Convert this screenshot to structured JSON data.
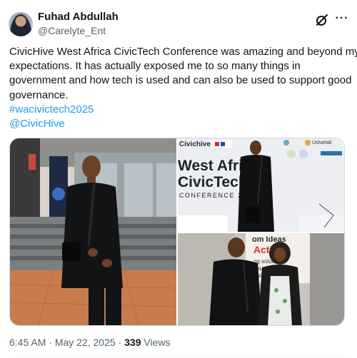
{
  "author": {
    "name": "Fuhad Abdullah",
    "handle": "@Carelyte_Ent"
  },
  "tweet": {
    "lines": [
      "CivicHive West Africa CivicTech Conference was amazing and beyond my",
      "expectations. It has actually exposed me to so many things in",
      "government and how tech is used and can also be used to support good",
      "governance."
    ],
    "hashtag": "#wacivictech2025",
    "mention": "@CivicHive"
  },
  "photos": {
    "banner_brand": "Civichive",
    "banner_title_line1": "West Africa",
    "banner_title_line2": "CivicTech",
    "banner_subtitle": "CONFERENCE 2",
    "banner_partner": "Ushahidi",
    "banner3_text_line1": "om Ideas",
    "banner3_text_line2": "Actio",
    "banner3_text_line3": "ng solutions,",
    "banner3_text_line4": "countable",
    "banner3_text_line5": "buil"
  },
  "meta": {
    "time": "6:45 AM",
    "separator": "·",
    "date": "May 22, 2025",
    "views_count": "339",
    "views_label": "Views"
  },
  "icons": {
    "grok": "grok-icon",
    "more": "more-icon"
  },
  "colors": {
    "link": "#1d9bf0",
    "text": "#0f1419",
    "secondary": "#536471"
  }
}
